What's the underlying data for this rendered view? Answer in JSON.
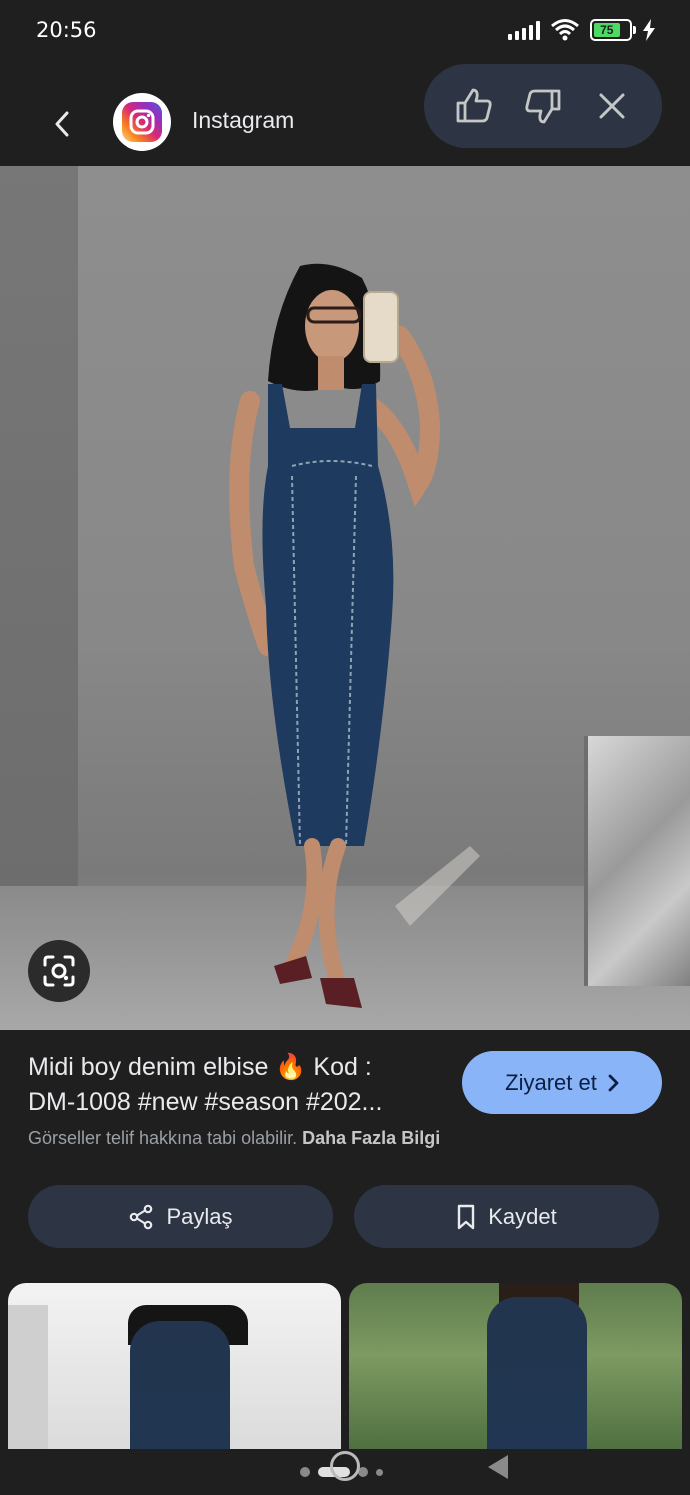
{
  "status_bar": {
    "time": "20:56",
    "battery_level": "75",
    "signal_icon": "signal-icon",
    "wifi_icon": "wifi-icon",
    "charging_icon": "bolt-icon"
  },
  "header": {
    "source_name": "Instagram",
    "back_icon": "chevron-left-icon",
    "feedback": {
      "like_icon": "thumbs-up-icon",
      "dislike_icon": "thumbs-down-icon",
      "close_icon": "close-icon"
    }
  },
  "result": {
    "caption_line1": "Midi boy denim elbise 🔥 Kod :",
    "caption_line2": "DM-1008 #new #season #202...",
    "visit_label": "Ziyaret et",
    "copyright_text": "Görseller telif hakkına tabi olabilir.",
    "more_info_label": "Daha Fazla Bilgi"
  },
  "actions": {
    "share_label": "Paylaş",
    "save_label": "Kaydet"
  },
  "colors": {
    "background": "#1f1f1f",
    "pill": "#2d3544",
    "accent": "#8ab4f8",
    "battery_green": "#4cd964"
  }
}
